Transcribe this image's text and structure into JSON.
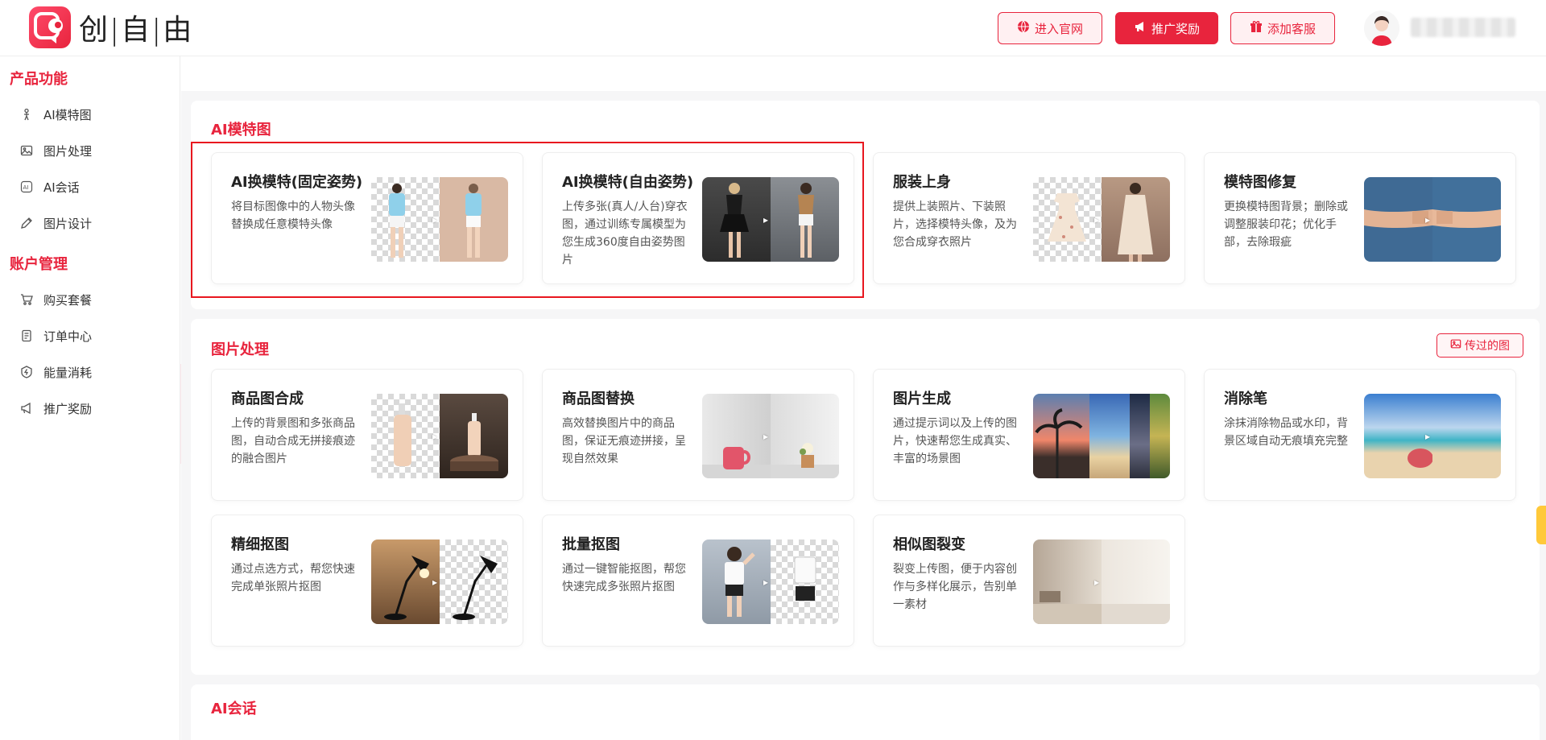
{
  "header": {
    "logo_text": "创|自|由",
    "btn_website": "进入官网",
    "btn_promo": "推广奖励",
    "btn_service": "添加客服",
    "accent": "#e8243d"
  },
  "sidebar": {
    "section_product": "产品功能",
    "product_items": [
      {
        "label": "AI模特图",
        "icon": "model-icon"
      },
      {
        "label": "图片处理",
        "icon": "image-icon"
      },
      {
        "label": "AI会话",
        "icon": "ai-chat-icon"
      },
      {
        "label": "图片设计",
        "icon": "design-icon"
      }
    ],
    "section_account": "账户管理",
    "account_items": [
      {
        "label": "购买套餐",
        "icon": "cart-icon"
      },
      {
        "label": "订单中心",
        "icon": "order-icon"
      },
      {
        "label": "能量消耗",
        "icon": "energy-icon"
      },
      {
        "label": "推广奖励",
        "icon": "megaphone-icon"
      }
    ]
  },
  "sections": {
    "ai_model": {
      "title": "AI模特图",
      "cards": [
        {
          "title": "AI换模特(固定姿势)",
          "desc": "将目标图像中的人物头像替换成任意模特头像"
        },
        {
          "title": "AI换模特(自由姿势)",
          "desc": "上传多张(真人/人台)穿衣图，通过训练专属模型为您生成360度自由姿势图片"
        },
        {
          "title": "服装上身",
          "desc": "提供上装照片、下装照片，选择模特头像，及为您合成穿衣照片"
        },
        {
          "title": "模特图修复",
          "desc": "更换模特图背景；删除或调整服装印花；优化手部，去除瑕疵"
        }
      ]
    },
    "image_proc": {
      "title": "图片处理",
      "history_btn": "传过的图",
      "cards": [
        {
          "title": "商品图合成",
          "desc": "上传的背景图和多张商品图，自动合成无拼接痕迹的融合图片"
        },
        {
          "title": "商品图替换",
          "desc": "高效替换图片中的商品图，保证无痕迹拼接，呈现自然效果"
        },
        {
          "title": "图片生成",
          "desc": "通过提示词以及上传的图片，快速帮您生成真实、丰富的场景图"
        },
        {
          "title": "消除笔",
          "desc": "涂抹消除物品或水印，背景区域自动无痕填充完整"
        },
        {
          "title": "精细抠图",
          "desc": "通过点选方式，帮您快速完成单张照片抠图"
        },
        {
          "title": "批量抠图",
          "desc": "通过一键智能抠图，帮您快速完成多张照片抠图"
        },
        {
          "title": "相似图裂变",
          "desc": "裂变上传图，便于内容创作与多样化展示，告别单一素材"
        }
      ]
    },
    "ai_chat": {
      "title": "AI会话"
    }
  }
}
